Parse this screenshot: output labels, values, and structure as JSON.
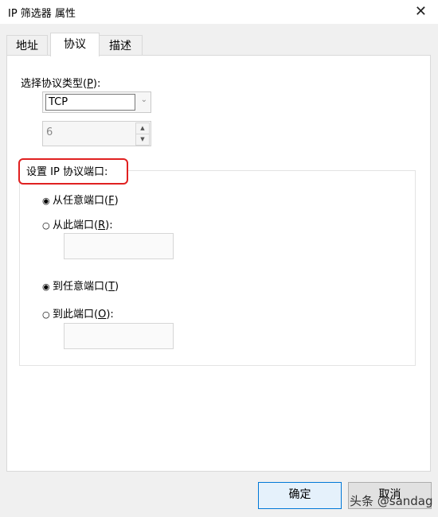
{
  "window": {
    "title": "IP 筛选器 属性",
    "close_glyph": "✕"
  },
  "tabs": [
    {
      "label": "地址",
      "active": false
    },
    {
      "label": "协议",
      "active": true
    },
    {
      "label": "描述",
      "active": false
    }
  ],
  "protocol": {
    "label_prefix": "选择协议类型(",
    "label_key": "P",
    "label_suffix": "):",
    "selected": "TCP",
    "number": "6"
  },
  "ports": {
    "group_title": "设置 IP 协议端口:",
    "from_any": {
      "prefix": "从任意端口(",
      "key": "F",
      "suffix": ")",
      "checked": true
    },
    "from_this": {
      "prefix": "从此端口(",
      "key": "R",
      "suffix": "):",
      "checked": false,
      "value": ""
    },
    "to_any": {
      "prefix": "到任意端口(",
      "key": "T",
      "suffix": ")",
      "checked": true
    },
    "to_this": {
      "prefix": "到此端口(",
      "key": "O",
      "suffix": "):",
      "checked": false,
      "value": ""
    },
    "radio_checked_glyph": "◉",
    "radio_unchecked_glyph": "○"
  },
  "buttons": {
    "ok": "确定",
    "cancel": "取消"
  },
  "watermark": "头条 @sandag",
  "icons": {
    "dropdown": "chevron-down-icon",
    "spin_up": "triangle-up-icon",
    "spin_down": "triangle-down-icon"
  }
}
